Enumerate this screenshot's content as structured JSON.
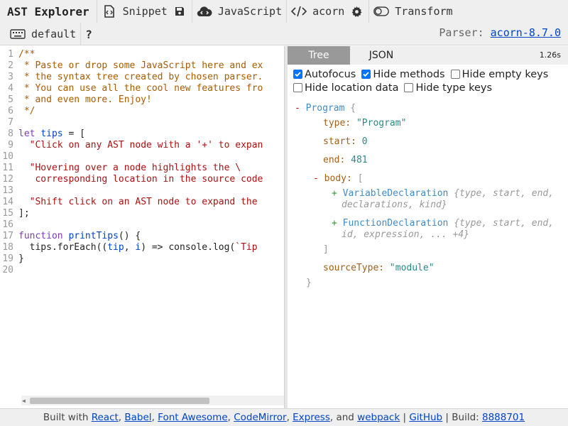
{
  "toolbar": {
    "app_title": "AST Explorer",
    "snippet_label": "Snippet",
    "language_label": "JavaScript",
    "parser_label": "acorn",
    "transform_label": "Transform",
    "keymap_label": "default",
    "help_label": "?",
    "parser_info_prefix": "Parser:",
    "parser_info_link": "acorn-8.7.0"
  },
  "editor": {
    "lines": [
      {
        "n": "1",
        "tokens": [
          {
            "t": "/**",
            "c": "c-com"
          },
          {
            "t": "",
            "c": "c-com"
          }
        ]
      },
      {
        "n": "2",
        "tokens": [
          {
            "t": " * Paste or drop some JavaScript here and ex",
            "c": "c-com"
          }
        ]
      },
      {
        "n": "3",
        "tokens": [
          {
            "t": " * the syntax tree created by chosen parser.",
            "c": "c-com"
          }
        ]
      },
      {
        "n": "4",
        "tokens": [
          {
            "t": " * You can use all the cool new features fro",
            "c": "c-com"
          }
        ]
      },
      {
        "n": "5",
        "tokens": [
          {
            "t": " * and even more. Enjoy!",
            "c": "c-com"
          }
        ]
      },
      {
        "n": "6",
        "tokens": [
          {
            "t": " */",
            "c": "c-com"
          }
        ]
      },
      {
        "n": "7",
        "tokens": []
      },
      {
        "n": "8",
        "tokens": [
          {
            "t": "let",
            "c": "c-kw"
          },
          {
            "t": " ",
            "c": "ct"
          },
          {
            "t": "tips",
            "c": "c-def"
          },
          {
            "t": " = [",
            "c": "ct"
          }
        ]
      },
      {
        "n": "9",
        "tokens": [
          {
            "t": "  ",
            "c": "ct"
          },
          {
            "t": "\"Click on any AST node with a '+' to expan",
            "c": "c-str"
          }
        ]
      },
      {
        "n": "10",
        "tokens": []
      },
      {
        "n": "11",
        "tokens": [
          {
            "t": "  ",
            "c": "ct"
          },
          {
            "t": "\"Hovering over a node highlights the \\",
            "c": "c-str"
          }
        ]
      },
      {
        "n": "12",
        "tokens": [
          {
            "t": "   corresponding location in the source code",
            "c": "c-str"
          }
        ]
      },
      {
        "n": "13",
        "tokens": []
      },
      {
        "n": "14",
        "tokens": [
          {
            "t": "  ",
            "c": "ct"
          },
          {
            "t": "\"Shift click on an AST node to expand the",
            "c": "c-str"
          }
        ]
      },
      {
        "n": "15",
        "tokens": [
          {
            "t": "];",
            "c": "ct"
          }
        ]
      },
      {
        "n": "16",
        "tokens": []
      },
      {
        "n": "17",
        "tokens": [
          {
            "t": "function",
            "c": "c-kw"
          },
          {
            "t": " ",
            "c": "ct"
          },
          {
            "t": "printTips",
            "c": "c-def"
          },
          {
            "t": "() {",
            "c": "ct"
          }
        ]
      },
      {
        "n": "18",
        "tokens": [
          {
            "t": "  tips.forEach((",
            "c": "ct"
          },
          {
            "t": "tip",
            "c": "c-def"
          },
          {
            "t": ", ",
            "c": "ct"
          },
          {
            "t": "i",
            "c": "c-def"
          },
          {
            "t": ") => console.log(",
            "c": "ct"
          },
          {
            "t": "`Tip",
            "c": "c-str"
          }
        ]
      },
      {
        "n": "19",
        "tokens": [
          {
            "t": "}",
            "c": "ct"
          }
        ]
      },
      {
        "n": "20",
        "tokens": []
      }
    ]
  },
  "output": {
    "tab_tree": "Tree",
    "tab_json": "JSON",
    "timing": "1.26s",
    "options": {
      "autofocus": {
        "label": "Autofocus",
        "checked": true
      },
      "hide_methods": {
        "label": "Hide methods",
        "checked": true
      },
      "hide_empty_keys": {
        "label": "Hide empty keys",
        "checked": false
      },
      "hide_location_data": {
        "label": "Hide location data",
        "checked": false
      },
      "hide_type_keys": {
        "label": "Hide type keys",
        "checked": false
      }
    },
    "tree": {
      "root_toggle": "-",
      "root_name": "Program",
      "open_brace": "{",
      "close_brace": "}",
      "type_key": "type:",
      "type_value": "\"Program\"",
      "start_key": "start:",
      "start_value": "0",
      "end_key": "end:",
      "end_value": "481",
      "body_toggle": "-",
      "body_key": "body:",
      "open_bracket": "[",
      "close_bracket": "]",
      "child1_toggle": "+",
      "child1_name": "VariableDeclaration",
      "child1_summary_1": "{type, start, end,",
      "child1_summary_2": "declarations, kind}",
      "child2_toggle": "+",
      "child2_name": "FunctionDeclaration",
      "child2_summary_1": "{type, start, end,",
      "child2_summary_2": "id, expression, ... +4}",
      "source_type_key": "sourceType:",
      "source_type_value": "\"module\""
    }
  },
  "footer": {
    "built_with": "Built with",
    "react": "React",
    "babel": "Babel",
    "font_awesome": "Font Awesome",
    "codemirror": "CodeMirror",
    "express": "Express",
    "and": "and",
    "webpack": "webpack",
    "github": "GitHub",
    "build_label": "Build:",
    "build_hash": "8888701"
  },
  "colors": {
    "link": "#0044cc",
    "active_tab": "#999999",
    "checkbox": "#0075ff"
  }
}
